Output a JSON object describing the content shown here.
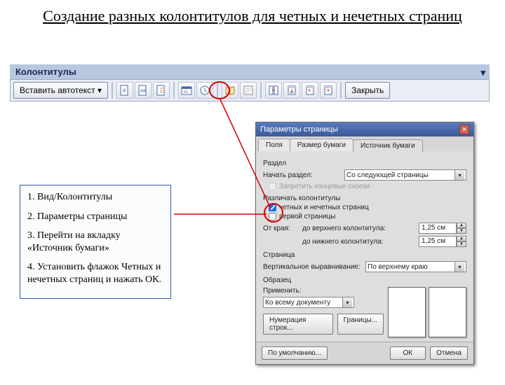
{
  "title": "Создание разных колонтитулов для четных и нечетных страниц",
  "toolbar": {
    "label": "Колонтитулы",
    "autotext": "Вставить автотекст ▾",
    "close": "Закрыть"
  },
  "steps": {
    "s1": "1. Вид/Колонтитулы",
    "s2": "2. Параметры страницы",
    "s3": "3. Перейти на вкладку «Источник бумаги»",
    "s4": "4. Установить флажок Четных и нечетных страниц и нажать ОК."
  },
  "dlg": {
    "title": "Параметры страницы",
    "tabs": {
      "t1": "Поля",
      "t2": "Размер бумаги",
      "t3": "Источник бумаги"
    },
    "section": {
      "label": "Раздел",
      "start_label": "Начать раздел:",
      "start_value": "Со следующей страницы",
      "suppress": "Запретить концевые сноски"
    },
    "headers": {
      "label": "Различать колонтитулы",
      "odd_even": "четных и нечетных страниц",
      "first": "первой страницы",
      "from_edge": "От края:",
      "top_label": "до верхнего колонтитула:",
      "bot_label": "до нижнего колонтитула:",
      "top_val": "1,25 см",
      "bot_val": "1,25 см"
    },
    "page": {
      "label": "Страница",
      "valign_label": "Вертикальное выравнивание:",
      "valign_value": "По верхнему краю"
    },
    "preview": {
      "label": "Образец",
      "apply_label": "Применить:",
      "apply_value": "Ко всему документу"
    },
    "buttons": {
      "numbering": "Нумерация строк...",
      "borders": "Границы...",
      "default": "По умолчанию...",
      "ok": "ОК",
      "cancel": "Отмена"
    }
  }
}
